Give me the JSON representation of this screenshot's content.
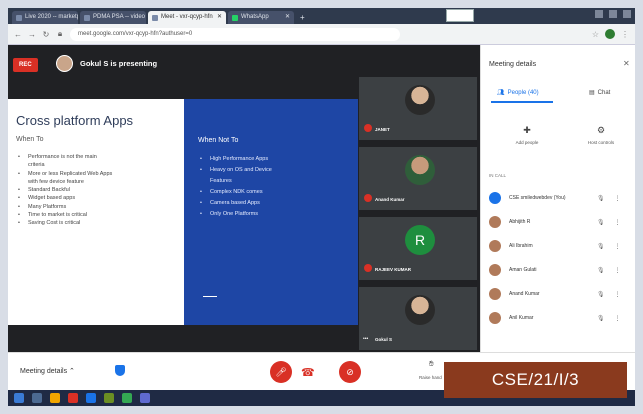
{
  "tabs": [
    {
      "label": "Live 2020 -- marketpanel"
    },
    {
      "label": "PDMA PSA -- video lecture"
    },
    {
      "label": "Meet - vxr-qcyp-hfn",
      "active": true
    },
    {
      "label": "WhatsApp"
    }
  ],
  "address": {
    "url": "meet.google.com/vxr-qcyp-hfn?authuser=0"
  },
  "meet": {
    "rec_label": "REC",
    "presenting": "Gokul S is presenting",
    "slide": {
      "title": "Cross platform Apps",
      "left_heading": "When To",
      "left_items": [
        {
          "text": "Performance is not the main",
          "bullet": true
        },
        {
          "text": "criteria",
          "bullet": false
        },
        {
          "text": "More or less Replicated Web Apps",
          "bullet": true
        },
        {
          "text": "with few device feature",
          "bullet": false
        },
        {
          "text": "Standard Backful",
          "bullet": true
        },
        {
          "text": "Widget based apps",
          "bullet": true
        },
        {
          "text": "Many Platforms",
          "bullet": true
        },
        {
          "text": "Time to market is critical",
          "bullet": true
        },
        {
          "text": "Saving Cost is critical",
          "bullet": true
        }
      ],
      "right_heading": "When Not To",
      "right_items": [
        {
          "text": "High Performance Apps",
          "bullet": true
        },
        {
          "text": "Heavy on OS and Device",
          "bullet": true
        },
        {
          "text": "Features",
          "bullet": false
        },
        {
          "text": "Complex NDK comes",
          "bullet": true
        },
        {
          "text": "Camera based Apps",
          "bullet": true
        },
        {
          "text": "Only One Platforms",
          "bullet": true
        }
      ]
    },
    "tiles": [
      {
        "name": "JANET",
        "avatar": "photo"
      },
      {
        "name": "Anand Kumar",
        "avatar": "greenbg"
      },
      {
        "name": "RAJEEV KUMAR",
        "avatar": "letter",
        "letter": "R"
      },
      {
        "name": "Gokul S",
        "avatar": "photo"
      }
    ]
  },
  "bottombar": {
    "meeting_details": "Meeting details",
    "raise_hand": "Raise hand"
  },
  "panel": {
    "title": "Meeting details",
    "tab_people": "People (40)",
    "tab_chat": "Chat",
    "btn_add": "Add people",
    "btn_host": "Host controls",
    "in_call": "IN CALL",
    "participants": [
      "CSE smiledwebdev (You)",
      "Abhijith R",
      "Ali Ibrahim",
      "Aman Gulati",
      "Anand Kumar",
      "Anil Kumar"
    ]
  },
  "watermark": "CSE/21/I/3",
  "colors": {
    "rec": "#d93025",
    "slide_blue": "#1e46a5",
    "accent": "#1a73e8",
    "watermark": "#8a3a1e"
  }
}
